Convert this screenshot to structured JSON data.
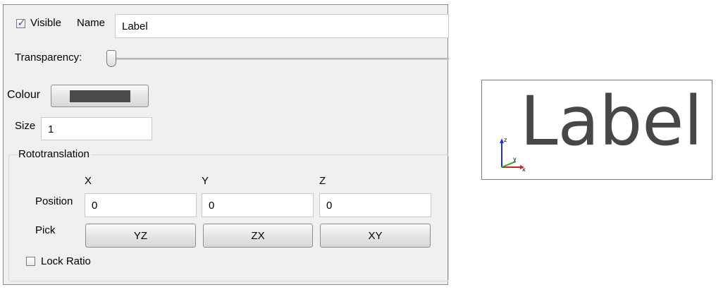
{
  "panel": {
    "visible": {
      "label": "Visible",
      "checked": true
    },
    "name": {
      "label": "Name",
      "value": "Label"
    },
    "transparency": {
      "label": "Transparency:",
      "value": 0
    },
    "colour": {
      "label": "Colour",
      "swatch_color": "#4a4a4a"
    },
    "size": {
      "label": "Size",
      "value": "1"
    },
    "rototranslation": {
      "title": "Rototranslation",
      "headers": [
        "X",
        "Y",
        "Z"
      ],
      "position_label": "Position",
      "position_values": [
        "0",
        "0",
        "0"
      ],
      "pick_label": "Pick",
      "pick_buttons": [
        "YZ",
        "ZX",
        "XY"
      ]
    },
    "lock_ratio": {
      "label": "Lock Ratio",
      "checked": false
    }
  },
  "preview": {
    "text": "Label",
    "text_color": "#474747",
    "axes": {
      "x": "x",
      "y": "y",
      "z": "z",
      "x_color": "#cc2222",
      "y_color": "#22aa22",
      "z_color": "#2233cc"
    }
  }
}
